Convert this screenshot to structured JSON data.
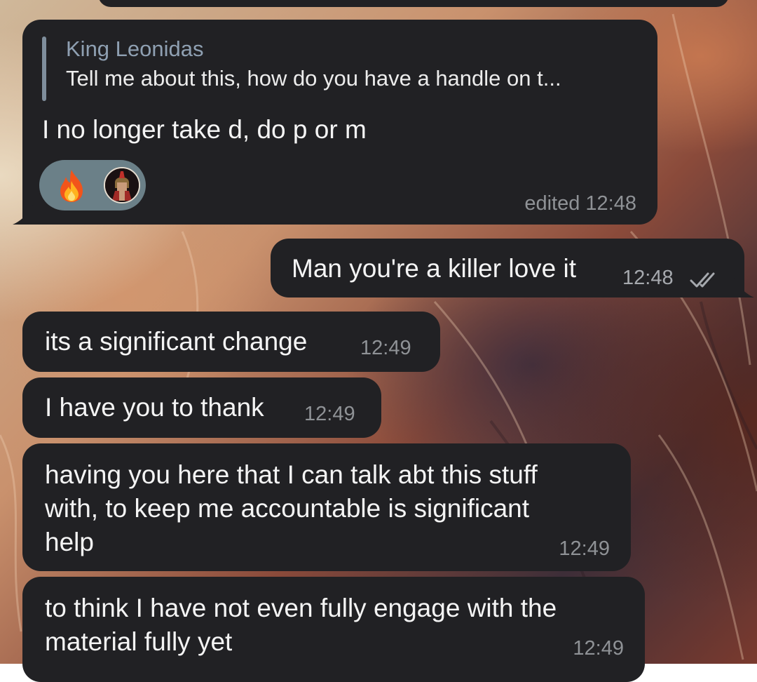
{
  "messages": [
    {
      "reply_to": {
        "name": "King Leonidas",
        "text": "Tell me about this, how do you have a handle on t..."
      },
      "text": "I no longer take d, do p or m",
      "reactions": [
        "fire-emoji",
        "spartan-avatar"
      ],
      "meta": "edited 12:48"
    },
    {
      "text": "Man you're a killer love it",
      "time": "12:48",
      "status": "read-double-check"
    },
    {
      "text": "its a significant change",
      "time": "12:49"
    },
    {
      "text": "I have you to thank",
      "time": "12:49"
    },
    {
      "lines": [
        "having you here that I can talk abt this stuff",
        "with, to keep me accountable is significant",
        "help"
      ],
      "time": "12:49"
    },
    {
      "lines": [
        "to think I have not even fully engage with the",
        "material fully yet"
      ],
      "time": "12:49"
    }
  ],
  "colors": {
    "bubble": "#212124",
    "time": "#8f9296",
    "reply_accent": "#8fa0b2",
    "reaction_pill": "#6b8088"
  }
}
